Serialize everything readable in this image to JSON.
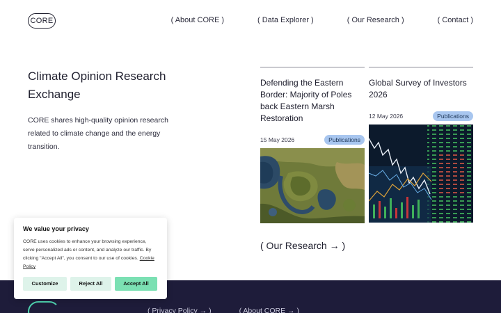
{
  "header": {
    "logo": "CORE",
    "nav": [
      "( About CORE )",
      "( Data Explorer )",
      "( Our Research )",
      "( Contact )"
    ]
  },
  "hero": {
    "title": "Climate Opinion Research Exchange",
    "description": "CORE shares high-quality opinion research related to climate change and the energy transition."
  },
  "cards": [
    {
      "title": "Defending the Eastern Border: Majority of Poles back Eastern Marsh Restoration",
      "date": "15 May 2026",
      "badge": "Publications",
      "image": "aerial-marsh-photo"
    },
    {
      "title": "Global Survey of Investors 2026",
      "date": "12 May 2026",
      "badge": "Publications",
      "image": "stock-chart-photo"
    }
  ],
  "research_link": "( Our Research → )",
  "cookie": {
    "title": "We value your privacy",
    "text": "CORE uses cookies to enhance your browsing experience, serve personalized ads or content, and analyze our traffic. By clicking \"Accept All\", you consent to our use of cookies.",
    "policy_link": "Cookie Policy",
    "buttons": {
      "customize": "Customize",
      "reject": "Reject All",
      "accept": "Accept All"
    }
  },
  "footer": {
    "links": [
      "( Privacy Policy → )",
      "( About CORE → )"
    ]
  },
  "colors": {
    "footer_bg": "#1e1c3a",
    "badge_bg": "#a8c6ef",
    "accept_bg": "#7be0b3",
    "secondary_btn_bg": "#def3ea",
    "footer_logo": "#4fd4b0"
  }
}
